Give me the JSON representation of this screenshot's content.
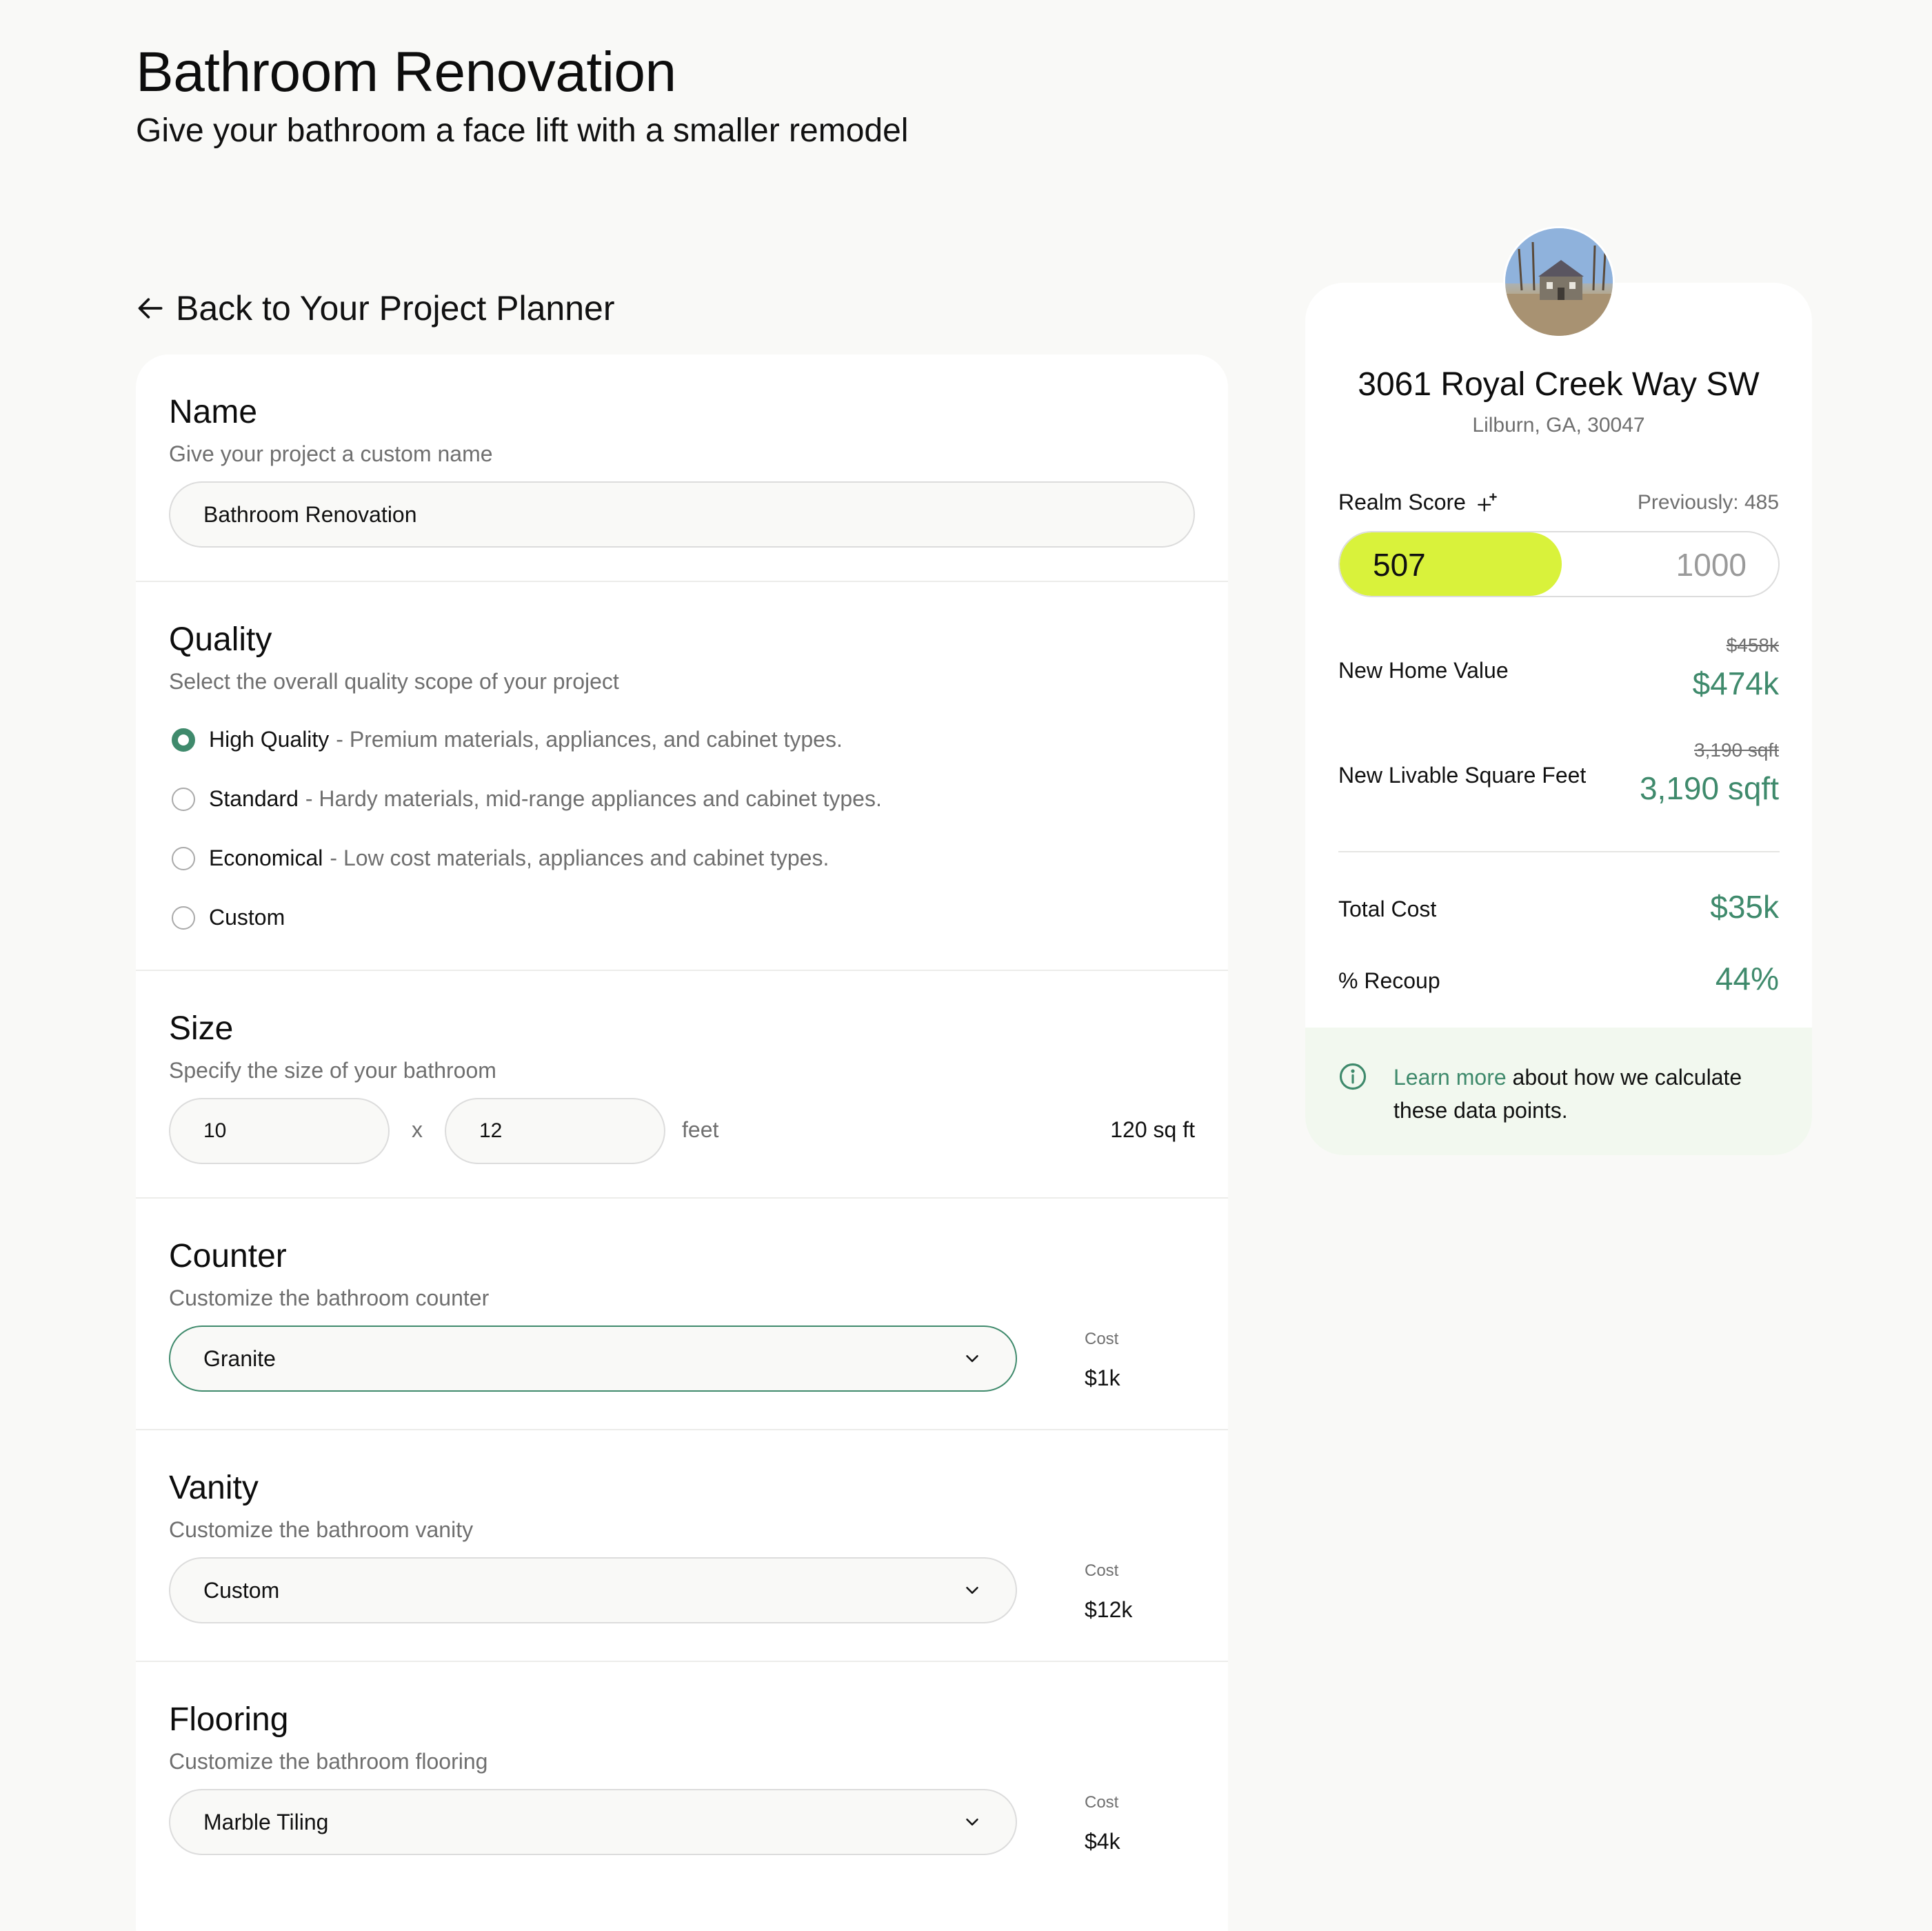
{
  "header": {
    "title": "Bathroom Renovation",
    "subtitle": "Give your bathroom a face lift with a smaller remodel"
  },
  "back_link": {
    "label": "Back to Your Project Planner",
    "icon": "arrow-left-icon"
  },
  "form": {
    "name": {
      "title": "Name",
      "description": "Give your project a custom name",
      "value": "Bathroom Renovation"
    },
    "quality": {
      "title": "Quality",
      "description": "Select the overall quality scope of your project",
      "options": [
        {
          "label": "High Quality",
          "description": "- Premium materials, appliances, and cabinet types.",
          "checked": true
        },
        {
          "label": "Standard",
          "description": "- Hardy materials, mid-range appliances and cabinet types.",
          "checked": false
        },
        {
          "label": "Economical",
          "description": "- Low cost materials, appliances and cabinet types.",
          "checked": false
        },
        {
          "label": "Custom",
          "description": "",
          "checked": false
        }
      ]
    },
    "size": {
      "title": "Size",
      "description": "Specify the size of your bathroom",
      "width": "10",
      "separator": "x",
      "length": "12",
      "unit": "feet",
      "total": "120 sq ft"
    },
    "counter": {
      "title": "Counter",
      "description": "Customize the bathroom counter",
      "selected": "Granite",
      "cost_label": "Cost",
      "cost": "$1k"
    },
    "vanity": {
      "title": "Vanity",
      "description": "Customize the bathroom vanity",
      "selected": "Custom",
      "cost_label": "Cost",
      "cost": "$12k"
    },
    "flooring": {
      "title": "Flooring",
      "description": "Customize the bathroom flooring",
      "selected": "Marble Tiling",
      "cost_label": "Cost",
      "cost": "$4k"
    }
  },
  "summary": {
    "address": "3061 Royal Creek Way SW",
    "city": "Lilburn, GA, 30047",
    "realm_score": {
      "label": "Realm Score",
      "icon": "sparkle-icon",
      "previous": "Previously: 485",
      "value": "507",
      "max": "1000",
      "fraction": 0.507
    },
    "home_value": {
      "label": "New Home Value",
      "old": "$458k",
      "new": "$474k"
    },
    "square_feet": {
      "label": "New Livable Square Feet",
      "old": "3,190 sqft",
      "new": "3,190 sqft"
    },
    "total_cost": {
      "label": "Total Cost",
      "value": "$35k"
    },
    "recoup": {
      "label": "% Recoup",
      "value": "44%"
    },
    "info": {
      "link": "Learn more",
      "text": " about how we calculate these data points."
    }
  },
  "colors": {
    "accent": "#3f8a6c",
    "score_fill": "#d9f23b",
    "info_bg": "#f2f8ef",
    "background": "#f9f9f7"
  }
}
